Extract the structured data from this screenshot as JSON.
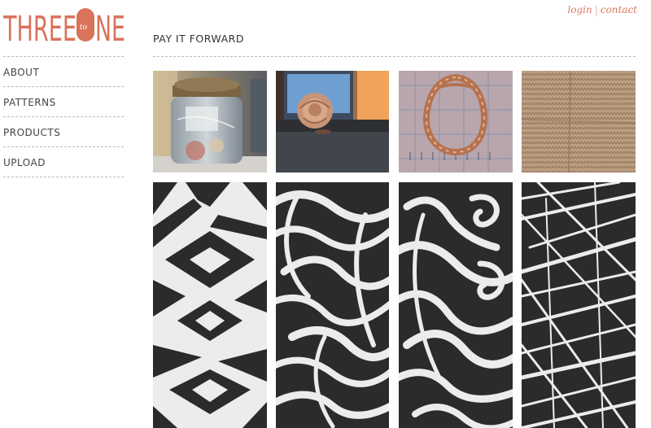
{
  "brand": {
    "left_word": "THREE",
    "connector": "to",
    "right_word": "NE",
    "color": "#d9735b"
  },
  "toplinks": {
    "login": "login",
    "separator": "|",
    "contact": "contact"
  },
  "nav": {
    "items": [
      "ABOUT",
      "PATTERNS",
      "PRODUCTS",
      "UPLOAD"
    ]
  },
  "page": {
    "title": "PAY IT FORWARD"
  },
  "gallery": {
    "photos": [
      {
        "subject": "jar-photo"
      },
      {
        "subject": "rose-photo"
      },
      {
        "subject": "hoop-earring-photo"
      },
      {
        "subject": "knit-texture-photo"
      }
    ],
    "prints": [
      {
        "subject": "zigzag-block-print"
      },
      {
        "subject": "wave-block-print"
      },
      {
        "subject": "swirl-block-print"
      },
      {
        "subject": "crosshatch-block-print"
      }
    ]
  }
}
